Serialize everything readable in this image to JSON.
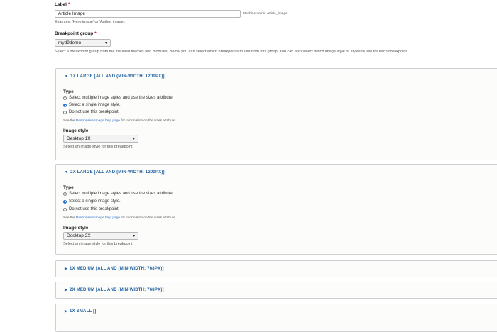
{
  "label_field": {
    "label": "Label",
    "required_mark": "*",
    "value": "Article Image",
    "machine_name": "Machine name: article_image",
    "description": "Example: 'Hero image' or 'Author image'."
  },
  "breakpoint_group": {
    "label": "Breakpoint group",
    "required_mark": "*",
    "selected": "myd9demo",
    "description": "Select a breakpoint group from the installed themes and modules. Below you can select which breakpoints to use from this group. You can also select which image style or styles to use for each breakpoint."
  },
  "breakpoints": [
    {
      "title": "1X LARGE [ALL AND (MIN-WIDTH: 1200PX)]",
      "expanded": true,
      "type_label": "Type",
      "options": [
        "Select multiple image styles and use the sizes attribute.",
        "Select a single image style.",
        "Do not use this breakpoint."
      ],
      "selected_option": 1,
      "help_prefix": "See the",
      "help_link": "Responsive Image help page",
      "help_suffix": "for information on the sizes attribute.",
      "style_label": "Image style",
      "style_value": "Desktop 1X",
      "style_description": "Select an image style for this breakpoint."
    },
    {
      "title": "2X LARGE [ALL AND (MIN-WIDTH: 1200PX)]",
      "expanded": true,
      "type_label": "Type",
      "options": [
        "Select multiple image styles and use the sizes attribute.",
        "Select a single image style.",
        "Do not use this breakpoint."
      ],
      "selected_option": 1,
      "help_prefix": "See the",
      "help_link": "Responsive Image help page",
      "help_suffix": "for information on the sizes attribute.",
      "style_label": "Image style",
      "style_value": "Desktop 2X",
      "style_description": "Select an image style for this breakpoint."
    },
    {
      "title": "1X MEDIUM [ALL AND (MIN-WIDTH: 768PX)]",
      "expanded": false
    },
    {
      "title": "2X MEDIUM [ALL AND (MIN-WIDTH: 768PX)]",
      "expanded": false
    },
    {
      "title": "1X SMALL []",
      "expanded": false
    }
  ],
  "icons": {
    "expanded": "triangle-down-icon",
    "collapsed": "triangle-right-icon",
    "select_arrow": "chevron-down-icon"
  },
  "colors": {
    "link": "#2a6ecf",
    "required": "#e00000",
    "panel_border": "#cfcfcf"
  }
}
